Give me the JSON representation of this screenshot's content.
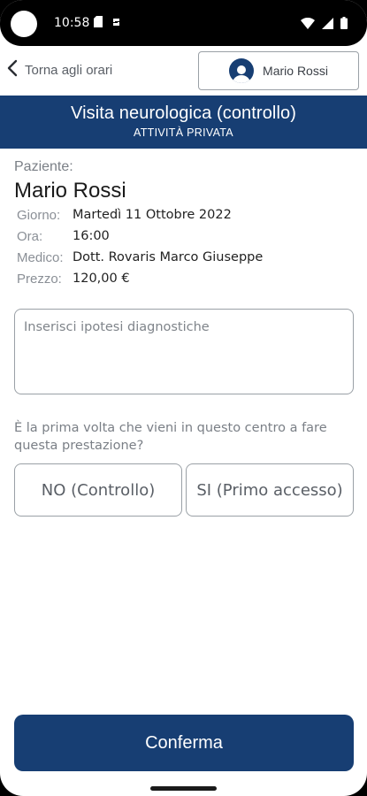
{
  "status_bar": {
    "time": "10:58",
    "icons": [
      "sd-card-icon",
      "sync-icon",
      "wifi-icon",
      "signal-icon",
      "battery-icon"
    ]
  },
  "header": {
    "back_label": "Torna agli orari",
    "user_name": "Mario Rossi"
  },
  "banner": {
    "title": "Visita neurologica (controllo)",
    "subtitle": "ATTIVITÀ PRIVATA"
  },
  "patient": {
    "label": "Paziente:",
    "name": "Mario Rossi",
    "details": [
      {
        "key": "Giorno:",
        "value": "Martedì 11 Ottobre 2022"
      },
      {
        "key": "Ora:",
        "value": "16:00"
      },
      {
        "key": "Medico:",
        "value": "Dott. Rovaris Marco Giuseppe"
      },
      {
        "key": "Prezzo:",
        "value": "120,00 €"
      }
    ]
  },
  "diagnosis": {
    "placeholder": "Inserisci ipotesi diagnostiche",
    "value": ""
  },
  "question": "È la prima volta che vieni in questo centro a fare questa prestazione?",
  "choices": {
    "no": "NO (Controllo)",
    "si": "SI (Primo accesso)"
  },
  "confirm_label": "Conferma",
  "colors": {
    "primary": "#173e73",
    "border": "#9aa0a6",
    "muted": "#7a7f86"
  }
}
